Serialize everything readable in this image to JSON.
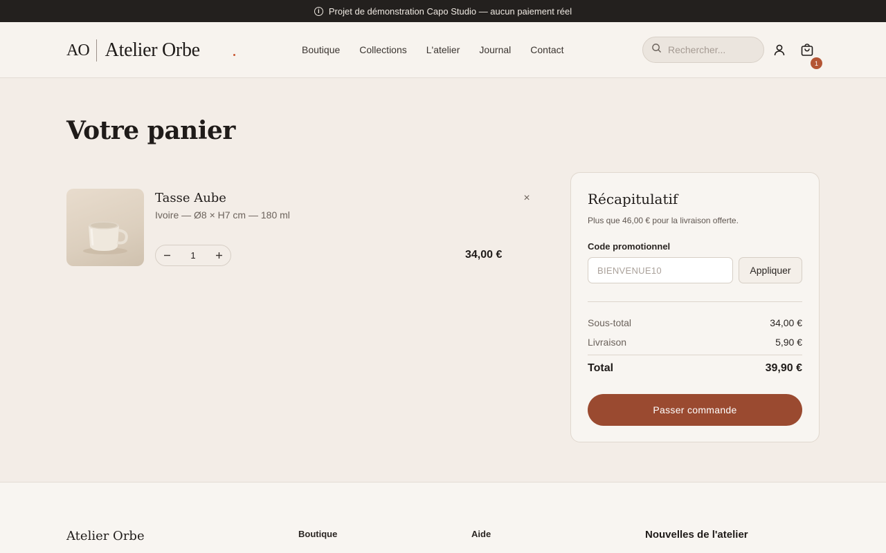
{
  "banner": {
    "text": "Projet de démonstration Capo Studio — aucun paiement réel",
    "icon": "info-icon"
  },
  "header": {
    "logo_mark": "AO",
    "logo_name": "Atelier Orbe",
    "nav": [
      "Boutique",
      "Collections",
      "L'atelier",
      "Journal",
      "Contact"
    ],
    "search_placeholder": "Rechercher...",
    "cart_count": "1"
  },
  "page": {
    "title": "Votre panier"
  },
  "cart": {
    "items": [
      {
        "name": "Tasse Aube",
        "meta": "Ivoire — Ø8 × H7 cm — 180 ml",
        "quantity": "1",
        "price": "34,00 €",
        "remove_symbol": "×"
      }
    ]
  },
  "summary": {
    "title": "Récapitulatif",
    "free_shipping_note": "Plus que 46,00 € pour la livraison offerte.",
    "promo_label": "Code promotionnel",
    "promo_placeholder": "BIENVENUE10",
    "promo_button": "Appliquer",
    "subtotal_label": "Sous-total",
    "subtotal_value": "34,00 €",
    "shipping_label": "Livraison",
    "shipping_value": "5,90 €",
    "total_label": "Total",
    "total_value": "39,90 €",
    "checkout_button": "Passer commande"
  },
  "footer": {
    "brand": "Atelier Orbe",
    "col1_heading": "Boutique",
    "col2_heading": "Aide",
    "newsletter_heading": "Nouvelles de l'atelier"
  },
  "colors": {
    "accent": "#9a4a30",
    "badge": "#b45534",
    "banner_bg": "#23201e",
    "page_bg": "#f3ede7"
  }
}
